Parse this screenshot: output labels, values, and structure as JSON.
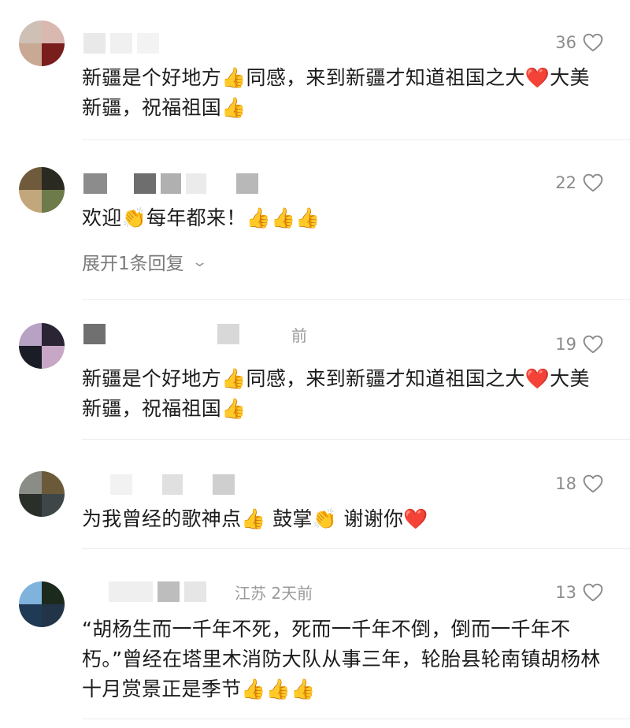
{
  "comments": [
    {
      "likes": "36",
      "meta": "",
      "text": "新疆是个好地方👍同感，来到新疆才知道祖国之大❤️大美新疆，祝福祖国👍",
      "avatar_colors": [
        "#cfc0b6",
        "#d9b8b0",
        "#c9a894",
        "#7a1d1d"
      ],
      "name_blocks": [
        "#e9e9e9",
        "#f0f0f0",
        "#f3f3f3"
      ]
    },
    {
      "likes": "22",
      "meta": "",
      "text": "欢迎👏每年都来！👍👍👍",
      "avatar_colors": [
        "#6f5a3c",
        "#2a2a22",
        "#c3a77c",
        "#6d7a4a"
      ],
      "name_blocks": [
        "#8c8c8c",
        "#b0b0b0",
        "#6e6e6e",
        "#a8a8a8",
        "#ebebeb",
        "#f6f6f6",
        "#b8b8b8"
      ]
    },
    {
      "likes": "19",
      "meta": "前",
      "text": "新疆是个好地方👍同感，来到新疆才知道祖国之大❤️大美新疆，祝福祖国👍",
      "avatar_colors": [
        "#b7a2c4",
        "#2a2434",
        "#1a1c26",
        "#c8a7c6"
      ],
      "name_blocks": [
        "#707070",
        "#ededed",
        "#d8d8d8"
      ]
    },
    {
      "likes": "18",
      "meta": "",
      "text": "为我曾经的歌神点👍 鼓掌👏 谢谢你❤️",
      "avatar_colors": [
        "#8a8d86",
        "#6b5a3a",
        "#2b2f2a",
        "#3e4648"
      ],
      "name_blocks": [
        "#f2f2f2",
        "#e0e0e0",
        "#cfcfcf"
      ]
    },
    {
      "likes": "13",
      "meta": "江苏 2天前",
      "text": "“胡杨生而一千年不死，死而一千年不倒，倒而一千年不朽。”曾经在塔里木消防大队从事三年，轮胎县轮南镇胡杨林十月赏景正是季节👍👍👍",
      "avatar_colors": [
        "#7fb2dc",
        "#1c2a1e",
        "#1f3a55",
        "#223447"
      ],
      "name_blocks": [
        "#efefef",
        "#bdbdbd",
        "#e6e6e6"
      ]
    }
  ],
  "reply_toggle": "展开1条回复",
  "icons": {
    "like": "heart-outline-icon",
    "expand": "chevron-down-icon"
  }
}
